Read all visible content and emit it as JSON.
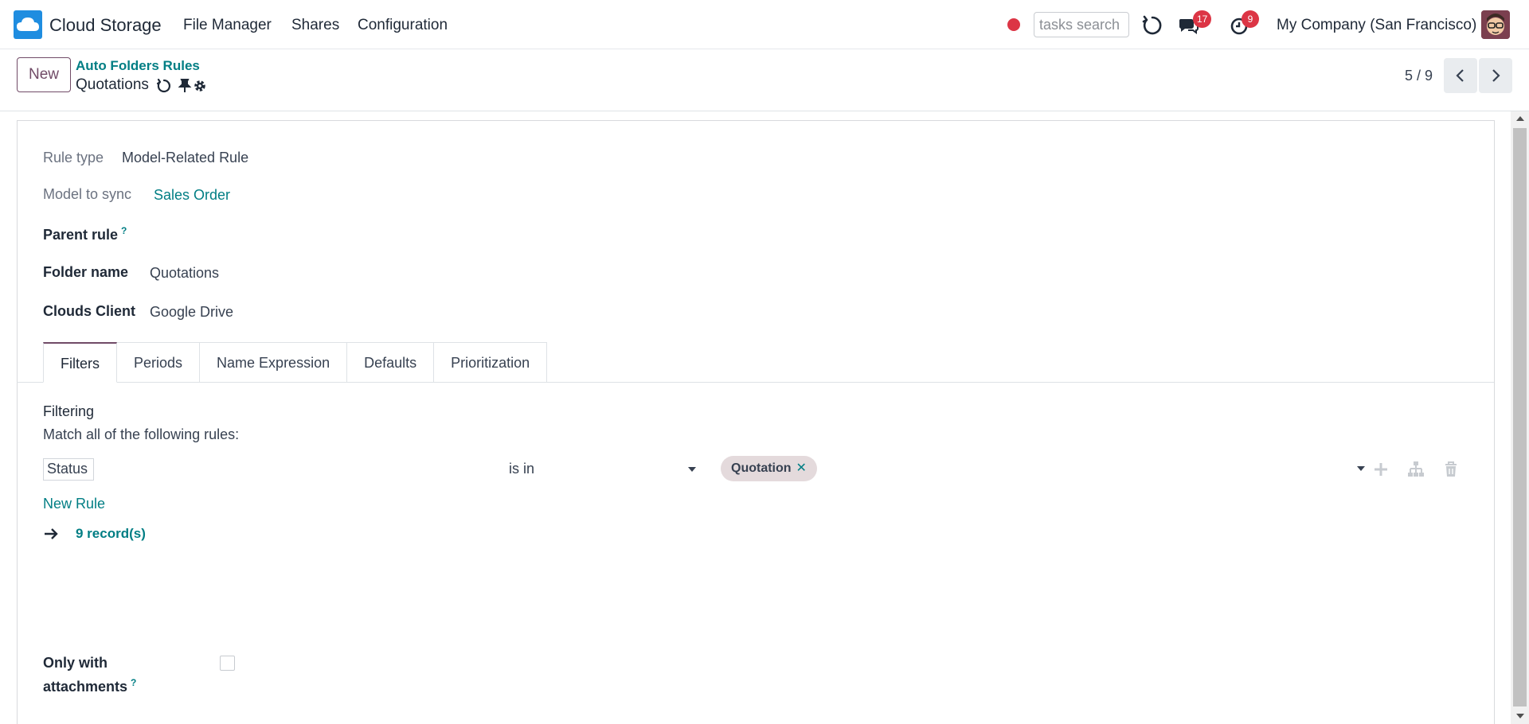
{
  "app": {
    "name": "Cloud Storage",
    "brand_color": "#1f8de0",
    "accent_color": "#714b67",
    "link_color": "#017e84"
  },
  "nav": {
    "menus": [
      "File Manager",
      "Shares",
      "Configuration"
    ],
    "search_placeholder": "tasks search",
    "messages_count": "17",
    "activities_count": "9",
    "company": "My Company (San Francisco)"
  },
  "control_panel": {
    "new_label": "New",
    "breadcrumb_parent": "Auto Folders Rules",
    "breadcrumb_current": "Quotations",
    "pager": "5 / 9"
  },
  "form": {
    "rule_type_label": "Rule type",
    "rule_type_value": "Model-Related Rule",
    "model_label": "Model to sync",
    "model_value": "Sales Order",
    "parent_label": "Parent rule",
    "help_mark": "?",
    "folder_label": "Folder name",
    "folder_value": "Quotations",
    "client_label": "Clouds Client",
    "client_value": "Google Drive",
    "attachments_label_1": "Only with",
    "attachments_label_2": "attachments",
    "attachments_checked": false
  },
  "tabs": [
    "Filters",
    "Periods",
    "Name Expression",
    "Defaults",
    "Prioritization"
  ],
  "filters": {
    "heading": "Filtering",
    "match_text": "Match all of the following rules:",
    "rule": {
      "field": "Status",
      "operator": "is in",
      "values": [
        "Quotation"
      ]
    },
    "new_rule_label": "New Rule",
    "records_label": "9 record(s)"
  }
}
